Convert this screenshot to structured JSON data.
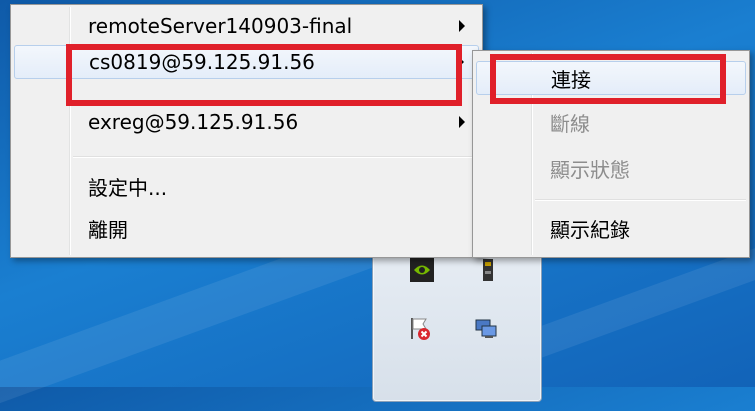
{
  "main_menu": {
    "items": [
      {
        "label": "remoteServer140903-final",
        "has_submenu": true
      },
      {
        "label": "cs0819@59.125.91.56",
        "has_submenu": true
      },
      {
        "label": "exreg@59.125.91.56",
        "has_submenu": true
      },
      {
        "label": "設定中..."
      },
      {
        "label": "離開"
      }
    ]
  },
  "sub_menu": {
    "items": [
      {
        "label": "連接",
        "enabled": true
      },
      {
        "label": "斷線",
        "enabled": false
      },
      {
        "label": "顯示狀態",
        "enabled": false
      },
      {
        "label": "顯示紀錄",
        "enabled": true
      }
    ]
  },
  "tray_icons": [
    "nvidia-icon",
    "usb-drive-icon",
    "action-center-flag-icon",
    "network-icon"
  ],
  "colors": {
    "highlight": "#e0202a",
    "desktop": "#1a7fd1",
    "menu_bg": "#f0f0f0"
  }
}
